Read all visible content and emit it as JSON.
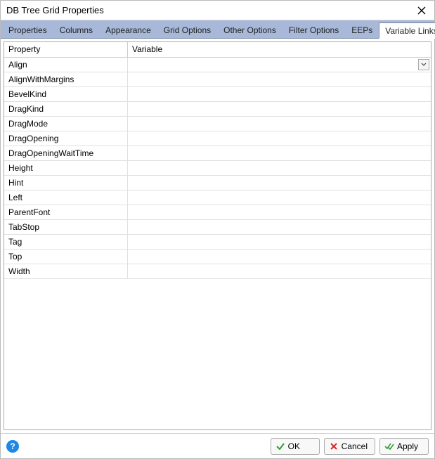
{
  "window": {
    "title": "DB Tree Grid Properties"
  },
  "tabs": [
    {
      "label": "Properties",
      "active": false
    },
    {
      "label": "Columns",
      "active": false
    },
    {
      "label": "Appearance",
      "active": false
    },
    {
      "label": "Grid Options",
      "active": false
    },
    {
      "label": "Other Options",
      "active": false
    },
    {
      "label": "Filter Options",
      "active": false
    },
    {
      "label": "EEPs",
      "active": false
    },
    {
      "label": "Variable Links",
      "active": true
    }
  ],
  "grid": {
    "columns": {
      "property": "Property",
      "variable": "Variable"
    },
    "rows": [
      {
        "property": "Align",
        "variable": "",
        "selected": true,
        "hasDropdown": true
      },
      {
        "property": "AlignWithMargins",
        "variable": ""
      },
      {
        "property": "BevelKind",
        "variable": ""
      },
      {
        "property": "DragKind",
        "variable": ""
      },
      {
        "property": "DragMode",
        "variable": ""
      },
      {
        "property": "DragOpening",
        "variable": ""
      },
      {
        "property": "DragOpeningWaitTime",
        "variable": ""
      },
      {
        "property": "Height",
        "variable": ""
      },
      {
        "property": "Hint",
        "variable": ""
      },
      {
        "property": "Left",
        "variable": ""
      },
      {
        "property": "ParentFont",
        "variable": ""
      },
      {
        "property": "TabStop",
        "variable": ""
      },
      {
        "property": "Tag",
        "variable": ""
      },
      {
        "property": "Top",
        "variable": ""
      },
      {
        "property": "Width",
        "variable": ""
      }
    ]
  },
  "buttons": {
    "ok": "OK",
    "cancel": "Cancel",
    "apply": "Apply",
    "help": "?"
  }
}
